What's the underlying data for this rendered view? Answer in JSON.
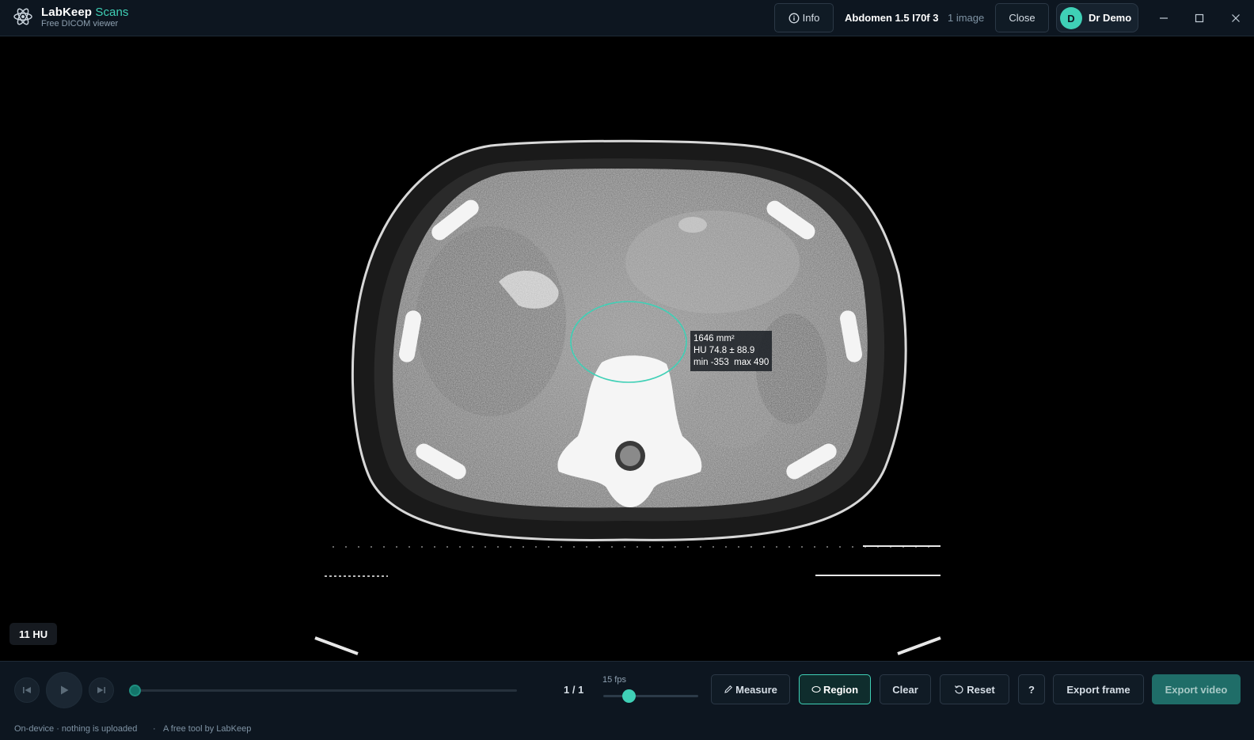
{
  "app": {
    "brand_name": "LabKeep",
    "brand_accent": "Scans",
    "subtitle": "Free DICOM viewer",
    "accent_color": "#3fd0b6"
  },
  "header": {
    "info_label": "Info",
    "study_title": "Abdomen 1.5 I70f 3",
    "image_count": "1 image",
    "close_label": "Close",
    "user_initial": "D",
    "user_name": "Dr Demo"
  },
  "roi": {
    "area": "1646 mm²",
    "hu_stats": "HU 74.8 ± 88.9",
    "min": "min -353",
    "max": "max 490"
  },
  "viewer": {
    "hu_readout": "11 HU"
  },
  "playback": {
    "frame_counter": "1 / 1",
    "fps_label": "15 fps",
    "frame_progress": 0,
    "fps_fraction": 0.27
  },
  "toolbar": {
    "measure_label": "Measure",
    "region_label": "Region",
    "clear_label": "Clear",
    "reset_label": "Reset",
    "help_label": "?",
    "export_frame_label": "Export frame",
    "export_video_label": "Export video"
  },
  "footer": {
    "privacy_note": "On-device · nothing is uploaded",
    "separator": "·",
    "credit": "A free tool by LabKeep"
  }
}
